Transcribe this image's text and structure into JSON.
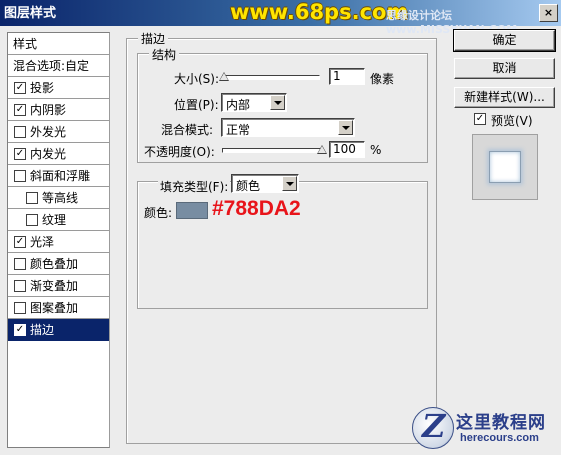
{
  "window": {
    "title": "图层样式",
    "watermark": "www.68ps.com",
    "forum_mark": "思缘设计论坛 www.MISSYUAN.COM",
    "close_label": "×"
  },
  "style_list": {
    "header": "样式",
    "blend_options": "混合选项:自定",
    "items": [
      {
        "label": "投影",
        "checked": true
      },
      {
        "label": "内阴影",
        "checked": true
      },
      {
        "label": "外发光",
        "checked": false
      },
      {
        "label": "内发光",
        "checked": true
      },
      {
        "label": "斜面和浮雕",
        "checked": false
      },
      {
        "label": "等高线",
        "checked": false
      },
      {
        "label": "纹理",
        "checked": false
      },
      {
        "label": "光泽",
        "checked": true
      },
      {
        "label": "颜色叠加",
        "checked": false
      },
      {
        "label": "渐变叠加",
        "checked": false
      },
      {
        "label": "图案叠加",
        "checked": false
      },
      {
        "label": "描边",
        "checked": true
      }
    ],
    "check_mark": "✓"
  },
  "stroke": {
    "title": "描边",
    "structure": {
      "title": "结构",
      "size_label": "大小(S):",
      "size_value": "1",
      "size_unit": "像素",
      "size_fraction": 0.0,
      "position_label": "位置(P):",
      "position_value": "内部",
      "blend_mode_label": "混合模式:",
      "blend_mode_value": "正常",
      "opacity_label": "不透明度(O):",
      "opacity_value": "100",
      "opacity_unit": "%",
      "opacity_fraction": 1.0
    },
    "fill": {
      "type_label": "填充类型(F):",
      "type_value": "颜色",
      "color_label": "颜色:",
      "color_hex": "#788da2",
      "color_annotation": "#788DA2"
    }
  },
  "buttons": {
    "ok": "确定",
    "cancel": "取消",
    "new_style": "新建样式(W)...",
    "preview_label": "预览(V)",
    "preview_checked": true
  },
  "logo": {
    "letter": "Z",
    "name": "这里教程网",
    "domain": "herecours.com"
  }
}
